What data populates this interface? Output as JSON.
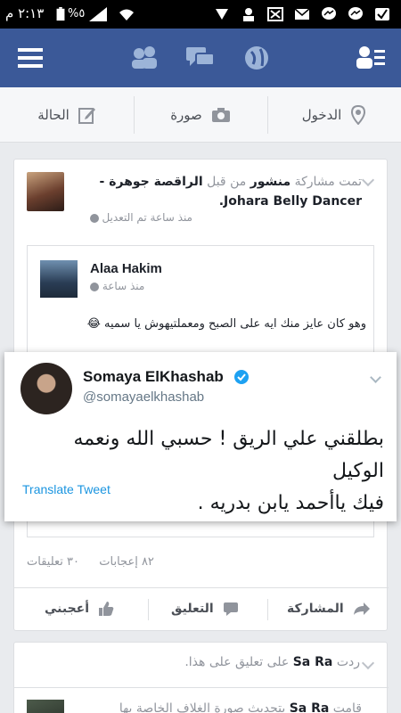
{
  "status_bar": {
    "time": "٢:١٣ م",
    "battery": "%٥"
  },
  "composer": {
    "checkin": "الدخول",
    "photo": "صورة",
    "status": "الحالة"
  },
  "post1": {
    "shared_prefix": "تمت مشاركة",
    "post_word": "منشور",
    "by": "من قبل",
    "page_name": "الراقصة جوهرة - Johara Belly Dancer",
    "page_name_end": ".",
    "time": "منذ ساعة تم التعديل",
    "shared": {
      "author": "Alaa Hakim",
      "time": "منذ ساعة",
      "text": "وهو كان عايز منك ايه على الصبح ومعملتيهوش يا سميه 😂"
    },
    "tweet": {
      "name": "Somaya ElKhashab",
      "handle": "@somayaelkhashab",
      "line1": "بطلقني علي الريق ! حسبي الله ونعمه الوكيل",
      "line2": "فيك ياأحمد يابن بدريه .",
      "translate": "Translate Tweet"
    },
    "stats": {
      "comments": "٣٠ تعليقات",
      "likes": "٨٢ إعجابات"
    },
    "actions": {
      "share": "المشاركة",
      "comment": "التعليق",
      "like": "أعجبني"
    }
  },
  "post2": {
    "reply_pre": "ردت",
    "name": "Sa Ra",
    "reply_post": "على تعليق على هذا.",
    "line2_pre": "قامت",
    "line2_name": "Sa Ra",
    "line2_post": "بتحديث صورة الغلاف الخاصة بها"
  },
  "colors": {
    "nav": "#3b5998",
    "link": "#365899",
    "verified": "#1da1f2",
    "translate": "#1b95e0"
  }
}
